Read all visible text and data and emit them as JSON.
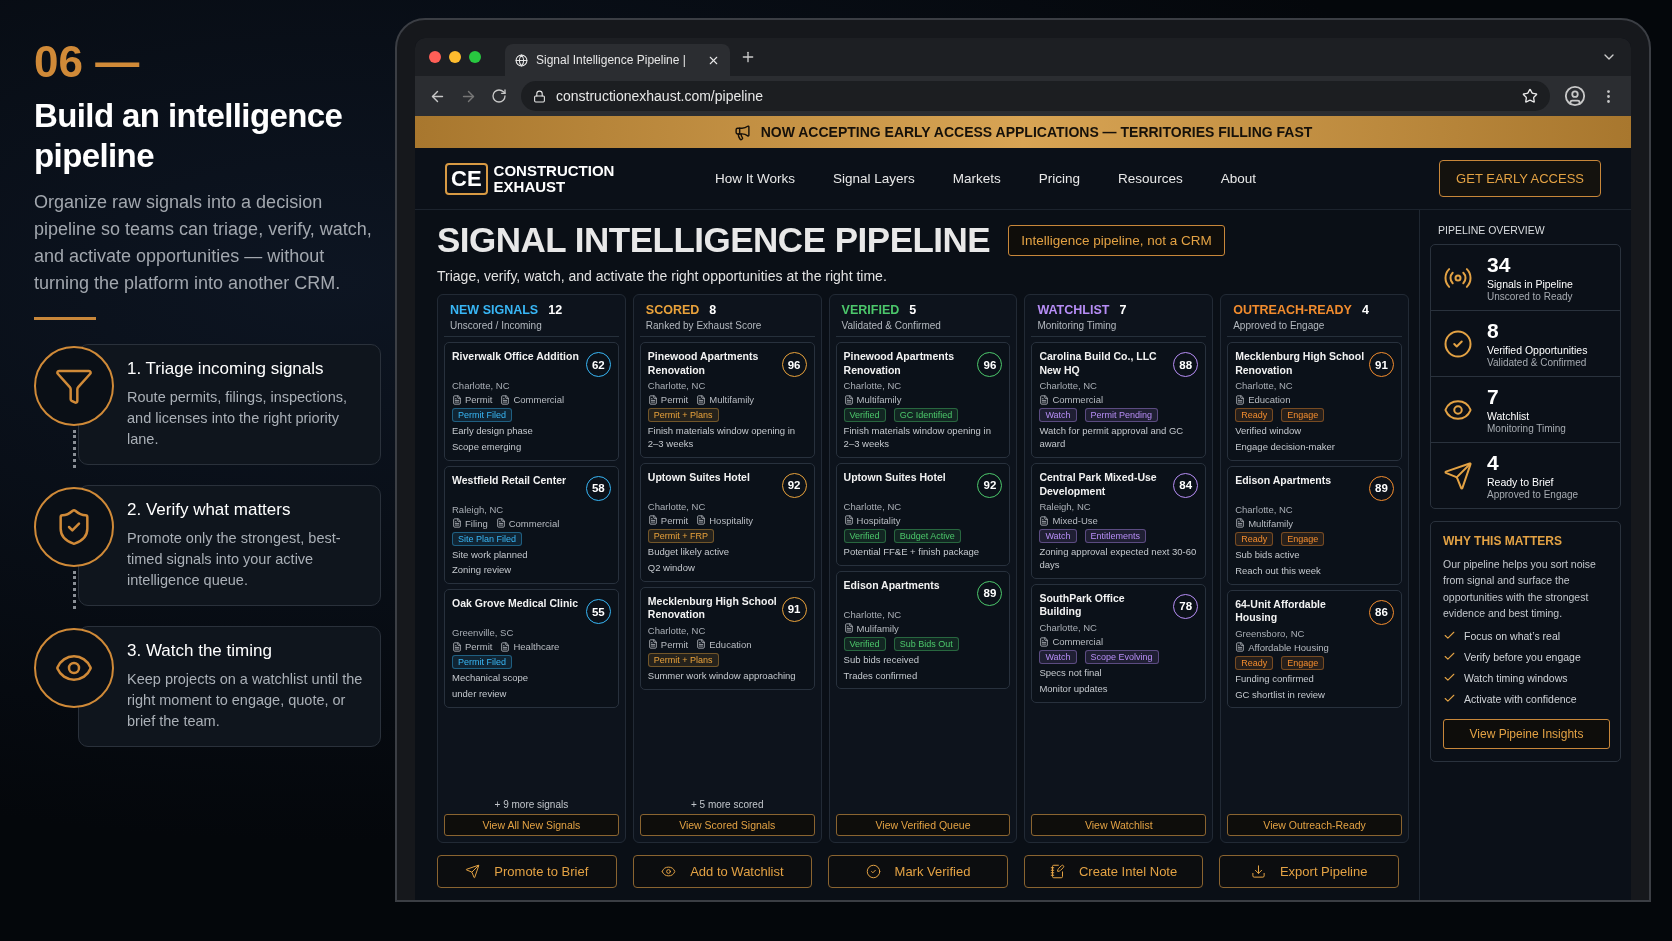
{
  "intro": {
    "step": "06 —",
    "heading": "Build an intelligence pipeline",
    "description": "Organize raw signals into a decision pipeline so teams can triage, verify, watch, and activate opportunities — without turning the platform into another CRM.",
    "steps": [
      {
        "kind": "funnel",
        "title": "1. Triage incoming signals",
        "text": "Route permits, filings, inspections, and licenses into the right priority lane."
      },
      {
        "kind": "shield",
        "title": "2. Verify what matters",
        "text": "Promote only the strongest, best-timed signals into your active intelligence queue."
      },
      {
        "kind": "eye",
        "title": "3. Watch the timing",
        "text": "Keep projects on a watchlist until the right moment to engage, quote, or brief the team."
      }
    ]
  },
  "browser": {
    "tab_title": "Signal Intelligence Pipeline |",
    "url": "constructionexhaust.com/pipeline"
  },
  "banner": "NOW ACCEPTING EARLY ACCESS APPLICATIONS — TERRITORIES FILLING FAST",
  "nav": {
    "logo_mark": "CE",
    "logo_name": "CONSTRUCTION EXHAUST",
    "items": [
      "How It Works",
      "Signal Layers",
      "Markets",
      "Pricing",
      "Resources",
      "About"
    ],
    "cta": "GET EARLY ACCESS"
  },
  "page": {
    "title": "SIGNAL INTELLIGENCE PIPELINE",
    "pill": "Intelligence pipeline, not a CRM",
    "subtitle": "Triage, verify, watch, and activate the right opportunities at the right time."
  },
  "columns": [
    {
      "title": "NEW SIGNALS",
      "count": "12",
      "subtitle": "Unscored / Incoming",
      "color": "#38b6f5",
      "more": "+ 9 more signals",
      "button": "View All New Signals",
      "cards": [
        {
          "title": "Riverwalk Office Addition",
          "location": "Charlotte, NC",
          "tags": [
            "Permit",
            "Commercial"
          ],
          "badges": [
            "Permit Filed"
          ],
          "notes": [
            "Early design phase",
            "Scope emerging"
          ],
          "score": "62"
        },
        {
          "title": "Westfield Retail Center",
          "location": "Raleigh, NC",
          "tags": [
            "Filing",
            "Commercial"
          ],
          "badges": [
            "Site Plan Filed"
          ],
          "notes": [
            "Site work planned",
            "Zoning review"
          ],
          "score": "58"
        },
        {
          "title": "Oak Grove Medical Clinic",
          "location": "Greenville, SC",
          "tags": [
            "Permit",
            "Healthcare"
          ],
          "badges": [
            "Permit Filed"
          ],
          "notes": [
            "Mechanical scope",
            "under review"
          ],
          "score": "55"
        }
      ]
    },
    {
      "title": "SCORED",
      "count": "8",
      "subtitle": "Ranked by Exhaust Score",
      "color": "#e9a23b",
      "more": "+ 5 more scored",
      "button": "View Scored Signals",
      "cards": [
        {
          "title": "Pinewood Apartments Renovation",
          "location": "Charlotte, NC",
          "tags": [
            "Permit",
            "Multifamily"
          ],
          "badges": [
            "Permit + Plans"
          ],
          "notes": [
            "Finish materials window opening in 2–3 weeks"
          ],
          "score": "96"
        },
        {
          "title": "Uptown Suites Hotel",
          "location": "Charlotte, NC",
          "tags": [
            "Permit",
            "Hospitality"
          ],
          "badges": [
            "Permit + FRP"
          ],
          "notes": [
            "Budget likely active",
            "Q2 window"
          ],
          "score": "92"
        },
        {
          "title": "Mecklenburg High School Renovation",
          "location": "Charlotte, NC",
          "tags": [
            "Permit",
            "Education"
          ],
          "badges": [
            "Permit + Plans"
          ],
          "notes": [
            "Summer work window approaching"
          ],
          "score": "91"
        }
      ]
    },
    {
      "title": "VERIFIED",
      "count": "5",
      "subtitle": "Validated & Confirmed",
      "color": "#4cc76b",
      "button": "View Verified Queue",
      "cards": [
        {
          "title": "Pinewood Apartments Renovation",
          "location": "Charlotte, NC",
          "tags": [
            "Multifamily"
          ],
          "badges": [
            "Verified",
            "GC Identified"
          ],
          "notes": [
            "Finish materials window opening in 2–3 weeks"
          ],
          "score": "96"
        },
        {
          "title": "Uptown Suites Hotel",
          "location": "Charlotte, NC",
          "tags": [
            "Hospitality"
          ],
          "badges": [
            "Verified",
            "Budget Active"
          ],
          "notes": [
            "Potential FF&E + finish package"
          ],
          "score": "92"
        },
        {
          "title": "Edison Apartments",
          "location": "Charlotte, NC",
          "tags": [
            "Mulifamily"
          ],
          "badges": [
            "Verified",
            "Sub Bids Out"
          ],
          "notes": [
            "Sub bids received",
            "Trades confirmed"
          ],
          "score": "89"
        }
      ]
    },
    {
      "title": "WATCHLIST",
      "count": "7",
      "subtitle": "Monitoring Timing",
      "color": "#b68df5",
      "button": "View Watchlist",
      "cards": [
        {
          "title": "Carolina Build Co., LLC New HQ",
          "location": "Charlotte, NC",
          "tags": [
            "Commercial"
          ],
          "badges": [
            "Watch",
            "Permit Pending"
          ],
          "notes": [
            "Watch for permit approval and GC award"
          ],
          "score": "88"
        },
        {
          "title": "Central Park Mixed-Use Development",
          "location": "Raleigh, NC",
          "tags": [
            "Mixed-Use"
          ],
          "badges": [
            "Watch",
            "Entitlements"
          ],
          "notes": [
            "Zoning approval expected next 30-60 days"
          ],
          "score": "84"
        },
        {
          "title": "SouthPark Office Building",
          "location": "Charlotte, NC",
          "tags": [
            "Commercial"
          ],
          "badges": [
            "Watch",
            "Scope Evolving"
          ],
          "notes": [
            "Specs not final",
            "Monitor updates"
          ],
          "score": "78"
        }
      ]
    },
    {
      "title": "OUTREACH-READY",
      "count": "4",
      "subtitle": "Approved to Engage",
      "color": "#f28c2e",
      "button": "View Outreach-Ready",
      "cards": [
        {
          "title": "Mecklenburg High School Renovation",
          "location": "Charlotte, NC",
          "tags": [
            "Education"
          ],
          "badges": [
            "Ready",
            "Engage"
          ],
          "notes": [
            "Verified window",
            "Engage decision-maker"
          ],
          "score": "91"
        },
        {
          "title": "Edison Apartments",
          "location": "Charlotte, NC",
          "tags": [
            "Multifamily"
          ],
          "badges": [
            "Ready",
            "Engage"
          ],
          "notes": [
            "Sub bids active",
            "Reach out this week"
          ],
          "score": "89"
        },
        {
          "title": "64-Unit Affordable Housing",
          "location": "Greensboro, NC",
          "tags": [
            "Affordable Housing"
          ],
          "badges": [
            "Ready",
            "Engage"
          ],
          "notes": [
            "Funding confirmed",
            "GC shortlist in review"
          ],
          "score": "86"
        }
      ]
    }
  ],
  "actions": [
    {
      "kind": "send",
      "label": "Promote to Brief"
    },
    {
      "kind": "eye",
      "label": "Add to Watchlist"
    },
    {
      "kind": "check",
      "label": "Mark Verified"
    },
    {
      "kind": "note",
      "label": "Create Intel Note"
    },
    {
      "kind": "download",
      "label": "Export Pipeline"
    }
  ],
  "sidebar": {
    "title": "PIPELINE OVERVIEW",
    "stats": [
      {
        "kind": "signal",
        "value": "34",
        "label": "Signals in Pipeline",
        "sublabel": "Unscored to Ready"
      },
      {
        "kind": "check",
        "value": "8",
        "label": "Verified Opportunities",
        "sublabel": "Validated & Confirmed"
      },
      {
        "kind": "eye",
        "value": "7",
        "label": "Watchlist",
        "sublabel": "Monitoring Timing"
      },
      {
        "kind": "send",
        "value": "4",
        "label": "Ready to Brief",
        "sublabel": "Approved to Engage"
      }
    ],
    "why": {
      "title": "WHY THIS MATTERS",
      "text": "Our pipeline helps you sort noise from signal and surface the opportunities with the strongest evidence and best timing.",
      "points": [
        "Focus on what’s real",
        "Verify before you engage",
        "Watch timing windows",
        "Activate with confidence"
      ],
      "button": "View Pipeine Insights"
    }
  }
}
